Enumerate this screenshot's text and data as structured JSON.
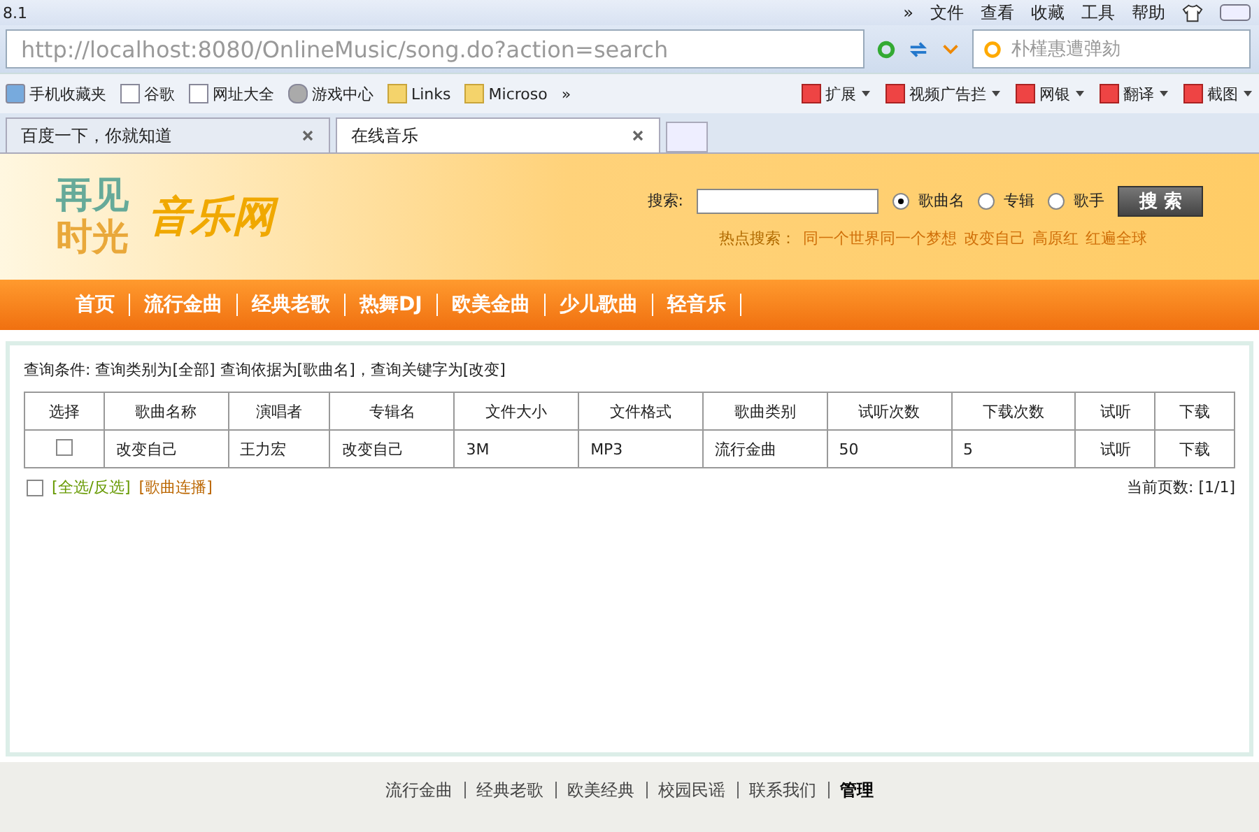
{
  "browser": {
    "title": "8.1",
    "menu": [
      "»",
      "文件",
      "查看",
      "收藏",
      "工具",
      "帮助"
    ],
    "address": "http://localhost:8080/OnlineMusic/song.do?action=search",
    "search_value": "朴槿惠遭弹劾",
    "bookmarks": [
      {
        "label": "手机收藏夹",
        "kind": "star"
      },
      {
        "label": "谷歌",
        "kind": "page"
      },
      {
        "label": "网址大全",
        "kind": "page"
      },
      {
        "label": "游戏中心",
        "kind": "game"
      },
      {
        "label": "Links",
        "kind": "folder"
      },
      {
        "label": "Microso",
        "kind": "folder"
      }
    ],
    "more": "»",
    "tools": [
      "扩展",
      "视频广告拦",
      "网银",
      "翻译",
      "截图"
    ],
    "tabs": [
      {
        "label": "百度一下，你就知道",
        "selected": false
      },
      {
        "label": "在线音乐",
        "selected": true
      }
    ]
  },
  "header": {
    "logo_a": "再见",
    "logo_b": "时光",
    "site": "音乐网",
    "search_label": "搜索:",
    "search_button": "搜 索",
    "options": [
      {
        "label": "歌曲名",
        "selected": true
      },
      {
        "label": "专辑",
        "selected": false
      },
      {
        "label": "歌手",
        "selected": false
      }
    ],
    "hot_label": "热点搜索：",
    "hot": [
      "同一个世界同一个梦想",
      "改变自己",
      "高原红",
      "红遍全球"
    ]
  },
  "nav": [
    "首页",
    "流行金曲",
    "经典老歌",
    "热舞DJ",
    "欧美金曲",
    "少儿歌曲",
    "轻音乐"
  ],
  "query": "查询条件: 查询类别为[全部] 查询依据为[歌曲名]，查询关键字为[改变]",
  "table": {
    "columns": [
      "选择",
      "歌曲名称",
      "演唱者",
      "专辑名",
      "文件大小",
      "文件格式",
      "歌曲类别",
      "试听次数",
      "下载次数",
      "试听",
      "下载"
    ],
    "rows": [
      {
        "checked": false,
        "cells": [
          "",
          "改变自己",
          "王力宏",
          "改变自己",
          "3M",
          "MP3",
          "流行金曲",
          "50",
          "5",
          "试听",
          "下载"
        ]
      }
    ]
  },
  "select_all": {
    "checked": false,
    "label": "[全选/反选]",
    "play": "[歌曲连播]"
  },
  "page_info": "当前页数: [1/1]",
  "footer": [
    "流行金曲",
    "经典老歌",
    "欧美经典",
    "校园民谣",
    "联系我们",
    "管理"
  ]
}
